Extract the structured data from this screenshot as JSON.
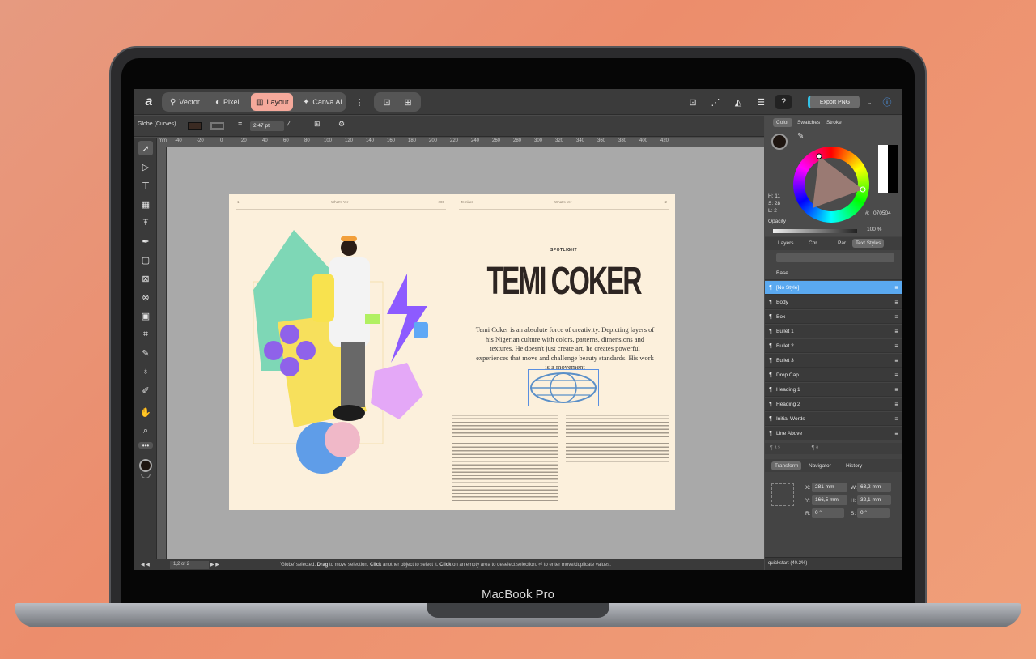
{
  "device_label": "MacBook Pro",
  "toolbar": {
    "personas": [
      {
        "label": "Vector",
        "icon": "vector-icon"
      },
      {
        "label": "Pixel",
        "icon": "pixel-icon"
      },
      {
        "label": "Layout",
        "icon": "layout-icon"
      },
      {
        "label": "Canva AI",
        "icon": "sparkle-icon"
      }
    ],
    "export_label": "Export PNG",
    "export_accent": "#33c2e7",
    "active_accent": "#f5a99b"
  },
  "context": {
    "selection": "Globe (Curves)",
    "stroke_width": "2,47 pt"
  },
  "ruler": {
    "unit": "mm",
    "ticks": [
      "-40",
      "-20",
      "0",
      "20",
      "40",
      "60",
      "80",
      "100",
      "120",
      "140",
      "160",
      "180",
      "200",
      "220",
      "240",
      "260",
      "280",
      "300",
      "320",
      "340",
      "360",
      "380",
      "400",
      "420"
    ]
  },
  "spread": {
    "left_header": {
      "num": "1",
      "title": "What's Yer",
      "folio": "200"
    },
    "right_header": {
      "left": "Temlara",
      "title": "What's Yer",
      "num": "2"
    },
    "kicker": "SPOTLIGHT",
    "headline": "TEMI COKER",
    "intro": "Temi Coker is an absolute force of creativity. Depicting layers of his Nigerian culture with colors, patterns, dimensions and textures. He doesn't just create art, he creates powerful experiences that move and challenge beauty standards. His work is a movement"
  },
  "color_panel": {
    "tabs": [
      "Color",
      "Swatches",
      "Stroke"
    ],
    "hue": "H: 11",
    "sat": "S: 28",
    "lum": "L: 2",
    "opacity_label": "Opacity",
    "opacity_value": "100 %",
    "hex_label": "#:",
    "hex": "070504"
  },
  "styles_panel": {
    "tabs": [
      "Layers",
      "Chr",
      "Par",
      "Text Styles"
    ],
    "base": "Base",
    "items": [
      "[No Style]",
      "Body",
      "Box",
      "Bullet 1",
      "Bullet 2",
      "Bullet 3",
      "Drop Cap",
      "Heading 1",
      "Heading 2",
      "Initial Words",
      "Line Above"
    ],
    "selected_color": "#5aa9f0"
  },
  "transform_panel": {
    "tabs": [
      "Transform",
      "Navigator",
      "History"
    ],
    "x_label": "X:",
    "x": "281 mm",
    "y_label": "Y:",
    "y": "166,5 mm",
    "w_label": "W:",
    "w": "63,2 mm",
    "h_label": "H:",
    "h": "32,1 mm",
    "r_label": "R:",
    "r": "0 °",
    "s_label": "S:",
    "s": "0 °"
  },
  "status": {
    "page": "1,2 of 2",
    "hint_pre": "'Globe' selected.",
    "drag": "Drag",
    "hint_mid": "to move selection.",
    "click": "Click",
    "hint_mid2": "another object to select it.",
    "click2": "Click",
    "hint_end": "on an empty area to deselect selection.",
    "hint_enter": "to enter move/duplicate values.",
    "doc": "quickstart (40.2%)"
  }
}
